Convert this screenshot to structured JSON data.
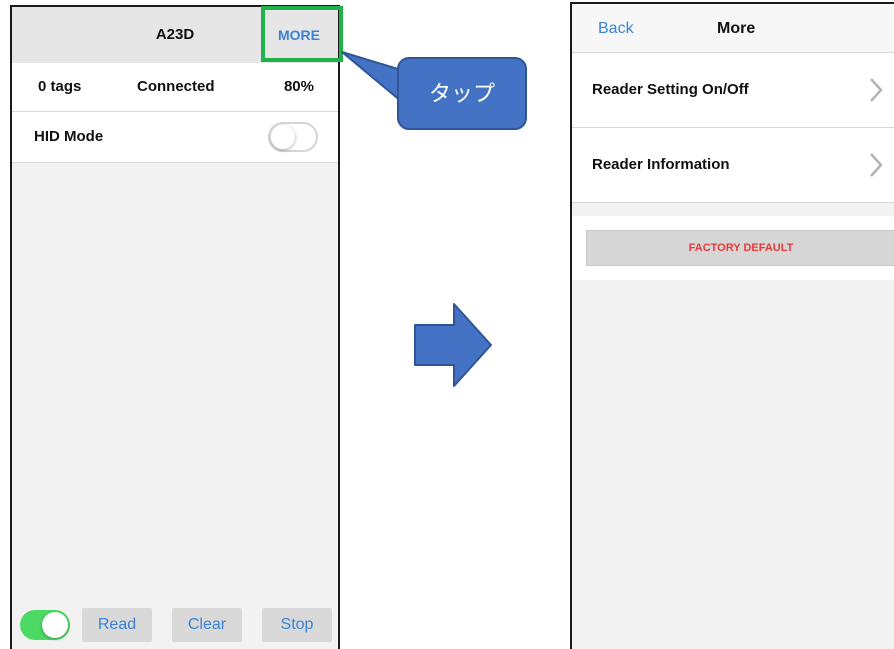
{
  "left_screen": {
    "title": "A23D",
    "more_label": "MORE",
    "status": {
      "tags": "0 tags",
      "connection": "Connected",
      "battery": "80%"
    },
    "hid_mode": {
      "label": "HID Mode",
      "enabled": false
    },
    "bottom_bar": {
      "toggle_enabled": true,
      "read_label": "Read",
      "clear_label": "Clear",
      "stop_label": "Stop"
    }
  },
  "annotation": {
    "callout_text": "タップ",
    "callout_color": "#4472c4",
    "highlight_color": "#1fb14a",
    "arrow_color": "#4472c4"
  },
  "right_screen": {
    "back_label": "Back",
    "title": "More",
    "menu_items": [
      {
        "label": "Reader Setting On/Off",
        "icon": "chevron-right-icon"
      },
      {
        "label": "Reader Information",
        "icon": "chevron-right-icon"
      }
    ],
    "factory_default_label": "FACTORY DEFAULT"
  },
  "colors": {
    "link_blue": "#3b82d6",
    "toggle_green": "#4cd964",
    "danger_red": "#e23b3b"
  }
}
